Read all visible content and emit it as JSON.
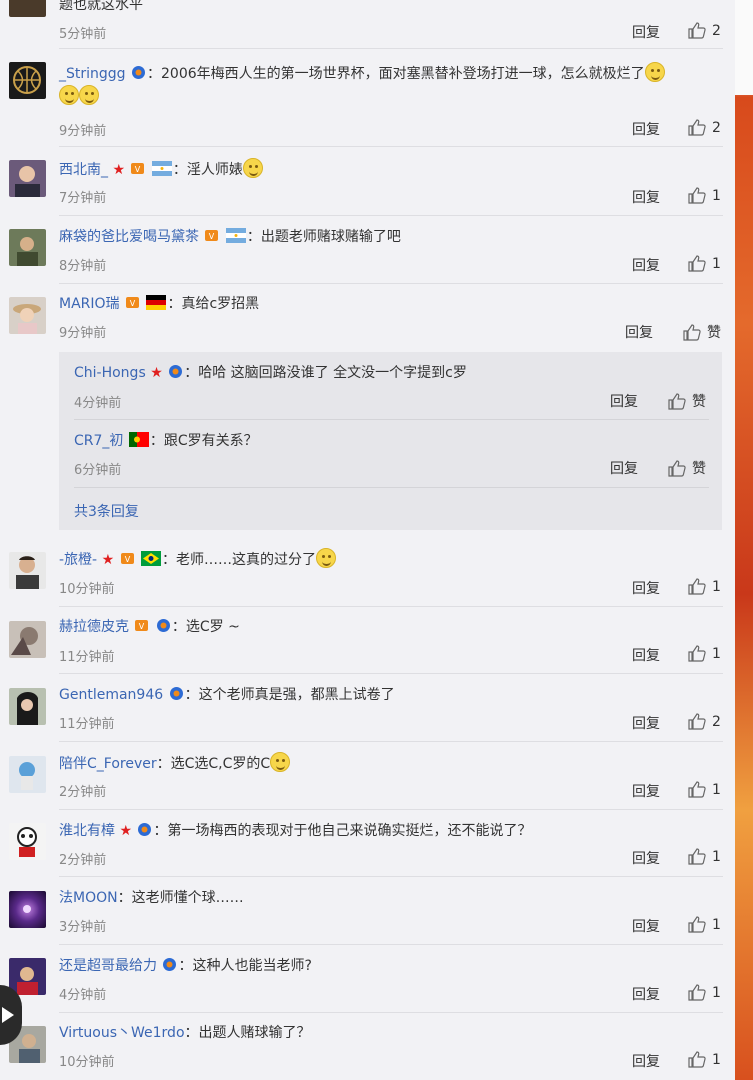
{
  "top_partial": {
    "text": "题也就这水平",
    "time": "5分钟前",
    "reply": "回复",
    "likes": "2"
  },
  "comments": [
    {
      "name": "_Stringgg",
      "text": "：2006年梅西人生的第一场世界杯，面对塞黑替补登场打进一球，怎么就极烂了",
      "time": "9分钟前",
      "reply": "回复",
      "likes": "2"
    },
    {
      "name": "西北南_",
      "text": "：淫人师婊",
      "time": "7分钟前",
      "reply": "回复",
      "likes": "1"
    },
    {
      "name": "麻袋的爸比爱喝马黛茶",
      "text": "：出题老师赌球赌输了吧",
      "time": "8分钟前",
      "reply": "回复",
      "likes": "1"
    },
    {
      "name": "MARIO瑞",
      "text": "：真给c罗招黑",
      "time": "9分钟前",
      "reply": "回复",
      "likes": "赞"
    },
    {
      "name": "-旅橙-",
      "text": "：老师……这真的过分了",
      "time": "10分钟前",
      "reply": "回复",
      "likes": "1"
    },
    {
      "name": "赫拉德皮克",
      "text": "：选C罗 ~",
      "time": "11分钟前",
      "reply": "回复",
      "likes": "1"
    },
    {
      "name": "Gentleman946",
      "text": "：这个老师真是强，都黑上试卷了",
      "time": "11分钟前",
      "reply": "回复",
      "likes": "2"
    },
    {
      "name": "陪伴C_Forever",
      "text": "：选C选C,C罗的C",
      "time": "2分钟前",
      "reply": "回复",
      "likes": "1"
    },
    {
      "name": "淮北有樟",
      "text": "：第一场梅西的表现对于他自己来说确实挺烂，还不能说了？",
      "time": "2分钟前",
      "reply": "回复",
      "likes": "1"
    },
    {
      "name": "法MOON",
      "text": "：这老师懂个球……",
      "time": "3分钟前",
      "reply": "回复",
      "likes": "1"
    },
    {
      "name": "还是超哥最给力",
      "text": "：这种人也能当老师?",
      "time": "4分钟前",
      "reply": "回复",
      "likes": "1"
    },
    {
      "name": "Virtuous丶We1rdo",
      "text": "：出题人赌球输了？",
      "time": "10分钟前",
      "reply": "回复",
      "likes": "1"
    }
  ],
  "sub_replies": [
    {
      "name": "Chi-Hongs",
      "text": "：哈哈 这脑回路没谁了 全文没一个字提到c罗",
      "time": "4分钟前",
      "reply": "回复",
      "likes": "赞"
    },
    {
      "name": "CR7_初",
      "text": "：跟C罗有关系？",
      "time": "6分钟前",
      "reply": "回复",
      "likes": "赞"
    }
  ],
  "sub_more": "共3条回复",
  "colors": {
    "link": "#3b66b3",
    "background": "#f2f2f5",
    "subbox": "#e6e6ea"
  }
}
